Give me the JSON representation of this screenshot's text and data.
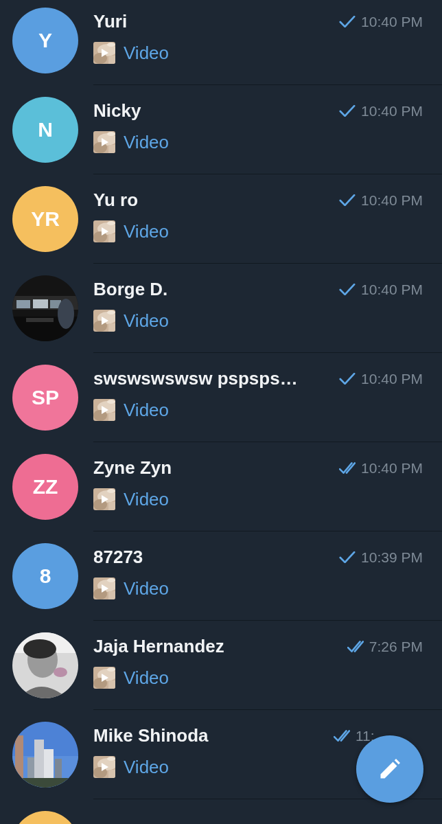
{
  "chats": [
    {
      "name": "Yuri",
      "avatar": {
        "kind": "letters",
        "initials": "Y",
        "color": "#5a9ee0"
      },
      "read": false,
      "time": "10:40 PM",
      "preview": "Video"
    },
    {
      "name": "Nicky",
      "avatar": {
        "kind": "letters",
        "initials": "N",
        "color": "#5bbfd9"
      },
      "read": false,
      "time": "10:40 PM",
      "preview": "Video"
    },
    {
      "name": "Yu ro",
      "avatar": {
        "kind": "letters",
        "initials": "YR",
        "color": "#f5bf5e"
      },
      "read": false,
      "time": "10:40 PM",
      "preview": "Video"
    },
    {
      "name": "Borge D.",
      "read": false,
      "time": "10:40 PM",
      "preview": "Video"
    },
    {
      "name": "swswswswsw pspsps…",
      "avatar": {
        "kind": "letters",
        "initials": "SP",
        "color": "#f0759a"
      },
      "read": false,
      "time": "10:40 PM",
      "preview": "Video"
    },
    {
      "name": "Zyne Zyn",
      "avatar": {
        "kind": "letters",
        "initials": "ZZ",
        "color": "#ee6d93"
      },
      "read": true,
      "time": "10:40 PM",
      "preview": "Video"
    },
    {
      "name": "87273",
      "avatar": {
        "kind": "letters",
        "initials": "8",
        "color": "#5a9ee0"
      },
      "read": false,
      "time": "10:39 PM",
      "preview": "Video"
    },
    {
      "name": "Jaja Hernandez",
      "read": true,
      "time": "7:26 PM",
      "preview": "Video"
    },
    {
      "name": "Mike Shinoda",
      "read": true,
      "time": "11:",
      "time_covered": true,
      "preview": "Video"
    },
    {
      "avatar": {
        "kind": "letters",
        "color": "#f5bf5e"
      }
    }
  ],
  "compose_button": {
    "kind": "pencil"
  }
}
